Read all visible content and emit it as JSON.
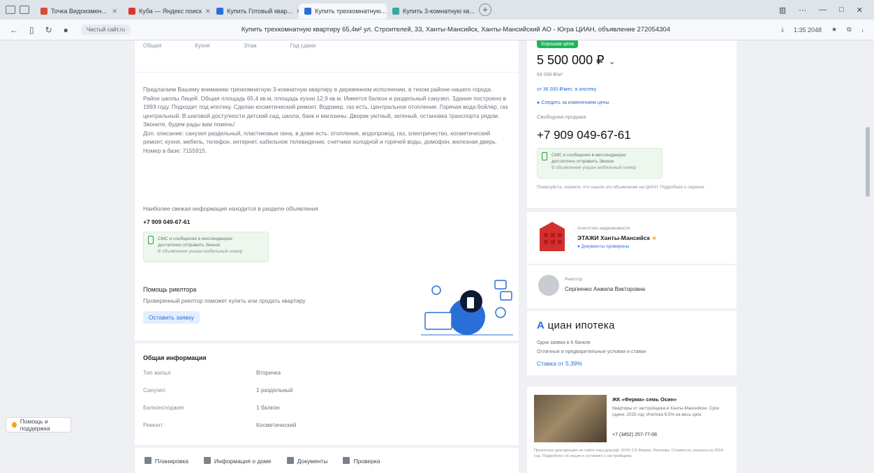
{
  "browser": {
    "tabs": [
      {
        "label": "Точка Видоизмен...",
        "color": "#d94a3a",
        "active": false
      },
      {
        "label": "Куба — Яндекс поиск",
        "color": "#e0352b",
        "active": false
      },
      {
        "label": "Купить Готовый квар...",
        "color": "#2a6fd8",
        "active": false
      },
      {
        "label": "Купить трехкомнатную...",
        "color": "#2a6fd8",
        "active": true
      },
      {
        "label": "Купить 3-комнатную кв...",
        "color": "#3aa8a0",
        "active": false
      }
    ],
    "new_tab": "+",
    "page_title": "Купить трехкомнатную квартиру 65,4м² ул. Строителей, 33, Ханты-Мансийск, Ханты-Мансийский АО - Югра ЦИАН, объявление 272054304",
    "url_pill": "Чистый сайт.ru",
    "zoom": "1:35 2048"
  },
  "listing": {
    "attrs_labels": [
      "Общая",
      "Кухня",
      "Этаж",
      "Год сдачи"
    ],
    "description": "Предлагаем Вашему вниманию трехкомнатную 3-комнатную квартиру в деревянном исполнении, в тихом районе нашего города. Район школы Лицей. Общая площадь 65,4 кв.м, площадь кухни 12,9 кв.м. Имеется балкон и раздельный санузел. Здание построено в 1993 году. Подходит под ипотеку. Сделан косметический ремонт. Водомер, газ есть. Центральное отопление. Горячая вода бойлер, газ центральный. В шаговой доступности детский сад, школа, банк и магазины. Дворик уютный, зеленый, остановка транспорта рядом.\nЗвоните, будем рады вам помочь!\nДоп. описание: санузел раздельный, пластиковые окна, в доме есть: отопление, водопровод, газ, электричество, косметический ремонт, кухня, мебель, телефон, интернет, кабельное телевидение, счетчики холодной и горячей воды, домофон, железная дверь. Номер в базе: 7155915.",
    "contact_note": "Наиболее свежая информация находится в разделе объявления",
    "contact_phone": "+7 909 049-67-61",
    "sms_line1": "СМС и сообщения в мессенджерах",
    "sms_line2": "достаточно отправить Звонок",
    "sms_line3": "В объявлении указан мобильный номер",
    "realtor_title": "Помощь риелтора",
    "realtor_text": "Проверенный риелтор поможет купить или продать квартиру",
    "realtor_btn": "Оставить заявку",
    "general_title": "Общая информация",
    "general_rows": [
      {
        "label": "Тип жилья",
        "value": "Вторичка"
      },
      {
        "label": "Санузел",
        "value": "1 раздельный"
      },
      {
        "label": "Балкон/лоджия",
        "value": "1 балкон"
      },
      {
        "label": "Ремонт",
        "value": "Косметический"
      }
    ],
    "footer_actions": [
      "Планировка",
      "Информация о доме",
      "Документы",
      "Проверка"
    ]
  },
  "sidebar": {
    "badge": "Хорошая цена",
    "price": "5 500 000 ₽",
    "price_per": "84 098 ₽/м²",
    "mortgage_link": "от 36 000 ₽/мес. в ипотеку",
    "watch_link": "Следить за изменением цены",
    "sale_type": "Свободная продажа",
    "phone": "+7 909 049-67-61",
    "sms_line1": "СМС и сообщения в мессенджерах",
    "sms_line2": "достаточно отправить Звонок",
    "sms_line3": "В объявлении указан мобильный номер",
    "sms_note": "Пожалуйста, скажите, что нашли это объявление на ЦИАН. Подробнее о сервисе",
    "agency_caption": "Агентство недвижимости",
    "agency_name": "ЭТАЖИ Ханты-Мансийск",
    "agency_sub": "Документы проверены",
    "agent_caption": "Риелтор",
    "agent_name": "Сергеенко Анжела Викторовна",
    "mortgage_brand": "циан ипотека",
    "mortgage_l1": "Одна заявка в 6 банков",
    "mortgage_l2": "Отличные и предварительные условия и ставки",
    "mortgage_rate": "Ставка от 5,39%",
    "ad_title": "ЖК «Ферма» семь Осин»",
    "ad_text": "Квартиры от застройщика в Ханты-Мансийске. Срок сдачи: 2025 год. Ипотека 6,5% на весь срок",
    "ad_phone": "+7 (3452) 257-77-08",
    "ad_footer": "Проектная декларация на сайте наш.дом.рф. ООО СЗ Ферма. Реклама. Стоимость указана на 2024 год. Подробнее об акции и условиях у застройщика."
  },
  "help_label": "Помощь и поддержка"
}
